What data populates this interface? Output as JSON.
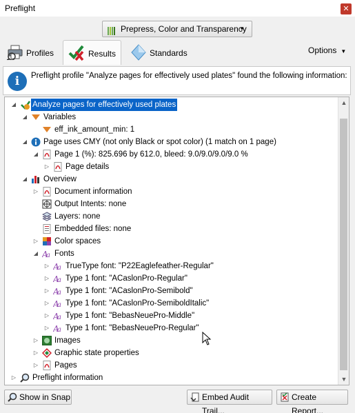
{
  "window": {
    "title": "Preflight",
    "close_glyph": "✕"
  },
  "profile_selector": {
    "value": "Prepress, Color and Transparency",
    "caret": "▼"
  },
  "tabs": [
    {
      "label": "Profiles",
      "icon": "printer-icon",
      "active": false
    },
    {
      "label": "Results",
      "icon": "checkmark-x-icon",
      "active": true
    },
    {
      "label": "Standards",
      "icon": "diamond-icon",
      "active": false
    }
  ],
  "options": {
    "label": "Options",
    "caret": "▼"
  },
  "info": {
    "icon_glyph": "i",
    "message": "Preflight profile \"Analyze pages for effectively used plates\" found the following information:"
  },
  "tree": {
    "rows": [
      {
        "text": "Analyze pages for effectively used plates",
        "level": 0,
        "expander": "expanded",
        "icon": "profile-icon",
        "selected": true
      },
      {
        "text": "Variables",
        "level": 1,
        "expander": "expanded",
        "icon": "variable-icon"
      },
      {
        "text": "eff_ink_amount_min: 1",
        "level": 2,
        "expander": "none",
        "icon": "variable-icon"
      },
      {
        "text": "Page uses CMY (not only Black or spot color) (1 match on 1 page)",
        "level": 1,
        "expander": "expanded",
        "icon": "info-icon"
      },
      {
        "text": "Page 1 (%): 825.696 by 612.0, bleed: 9.0/9.0/9.0/9.0 %",
        "level": 2,
        "expander": "expanded",
        "icon": "pdf-page-icon"
      },
      {
        "text": "Page details",
        "level": 3,
        "expander": "collapsed",
        "icon": "pdf-page-icon"
      },
      {
        "text": "Overview",
        "level": 1,
        "expander": "expanded",
        "icon": "overview-icon"
      },
      {
        "text": "Document information",
        "level": 2,
        "expander": "collapsed",
        "icon": "pdf-page-icon"
      },
      {
        "text": "Output Intents: none",
        "level": 2,
        "expander": "none",
        "icon": "output-intent-icon"
      },
      {
        "text": "Layers: none",
        "level": 2,
        "expander": "none",
        "icon": "layers-icon"
      },
      {
        "text": "Embedded files: none",
        "level": 2,
        "expander": "none",
        "icon": "embedded-file-icon"
      },
      {
        "text": "Color spaces",
        "level": 2,
        "expander": "collapsed",
        "icon": "color-spaces-icon"
      },
      {
        "text": "Fonts",
        "level": 2,
        "expander": "expanded",
        "icon": "font-icon"
      },
      {
        "text": "TrueType font: \"P22Eaglefeather-Regular\"",
        "level": 3,
        "expander": "collapsed",
        "icon": "font-icon"
      },
      {
        "text": "Type 1 font: \"ACaslonPro-Regular\"",
        "level": 3,
        "expander": "collapsed",
        "icon": "font-icon"
      },
      {
        "text": "Type 1 font: \"ACaslonPro-Semibold\"",
        "level": 3,
        "expander": "collapsed",
        "icon": "font-icon"
      },
      {
        "text": "Type 1 font: \"ACaslonPro-SemiboldItalic\"",
        "level": 3,
        "expander": "collapsed",
        "icon": "font-icon"
      },
      {
        "text": "Type 1 font: \"BebasNeuePro-Middle\"",
        "level": 3,
        "expander": "collapsed",
        "icon": "font-icon"
      },
      {
        "text": "Type 1 font: \"BebasNeuePro-Regular\"",
        "level": 3,
        "expander": "collapsed",
        "icon": "font-icon"
      },
      {
        "text": "Images",
        "level": 2,
        "expander": "collapsed",
        "icon": "image-icon"
      },
      {
        "text": "Graphic state properties",
        "level": 2,
        "expander": "collapsed",
        "icon": "graphic-state-icon"
      },
      {
        "text": "Pages",
        "level": 2,
        "expander": "collapsed",
        "icon": "pdf-page-icon"
      },
      {
        "text": "Preflight information",
        "level": 0,
        "expander": "collapsed",
        "icon": "magnifier-icon"
      }
    ]
  },
  "buttons": {
    "show_in_snap": "Show in Snap",
    "embed_audit_trail": "Embed Audit Trail...",
    "create_report": "Create Report..."
  },
  "colors": {
    "selection": "#0a64c8",
    "info_blue": "#1e6fb8",
    "close_red": "#c0392b"
  }
}
